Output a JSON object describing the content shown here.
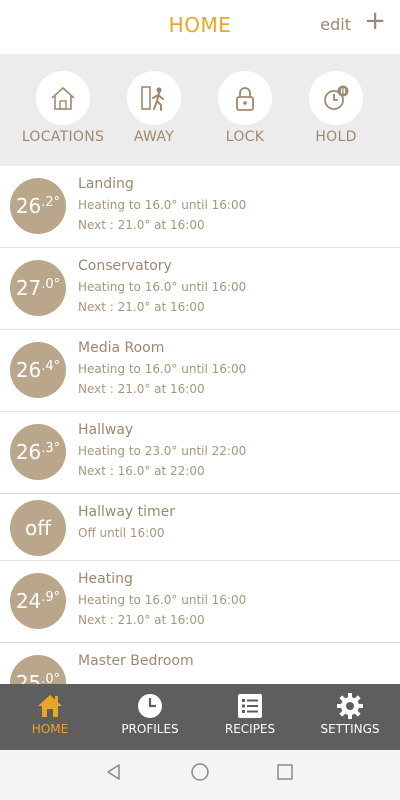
{
  "header": {
    "title": "HOME",
    "edit_label": "edit",
    "add_label": "+"
  },
  "actions": [
    {
      "label": "LOCATIONS",
      "icon": "home-outline-icon"
    },
    {
      "label": "AWAY",
      "icon": "person-exit-icon"
    },
    {
      "label": "LOCK",
      "icon": "padlock-icon"
    },
    {
      "label": "HOLD",
      "icon": "clock-pause-icon"
    }
  ],
  "zones": [
    {
      "name": "Landing",
      "temp_int": "26",
      "temp_dec": ".2°",
      "status": "Heating to 16.0° until 16:00",
      "next": "Next : 21.0° at 16:00"
    },
    {
      "name": "Conservatory",
      "temp_int": "27",
      "temp_dec": ".0°",
      "status": "Heating to 16.0° until 16:00",
      "next": "Next : 21.0° at 16:00"
    },
    {
      "name": "Media Room",
      "temp_int": "26",
      "temp_dec": ".4°",
      "status": "Heating to 16.0° until 16:00",
      "next": "Next : 21.0° at 16:00"
    },
    {
      "name": "Hallway",
      "temp_int": "26",
      "temp_dec": ".3°",
      "status": "Heating to 23.0° until 22:00",
      "next": "Next : 16.0° at 22:00"
    },
    {
      "name": "Hallway timer",
      "temp_text": "off",
      "status": "Off until 16:00"
    },
    {
      "name": "Heating",
      "temp_int": "24",
      "temp_dec": ".9°",
      "status": "Heating to 16.0° until 16:00",
      "next": "Next : 21.0° at 16:00"
    },
    {
      "name": "Master Bedroom",
      "temp_int": "25",
      "temp_dec": ".0°"
    }
  ],
  "bottom_nav": [
    {
      "label": "HOME",
      "icon": "home-icon",
      "active": true
    },
    {
      "label": "PROFILES",
      "icon": "clock-icon"
    },
    {
      "label": "RECIPES",
      "icon": "list-icon"
    },
    {
      "label": "SETTINGS",
      "icon": "gear-icon"
    }
  ],
  "colors": {
    "accent": "#e8a628",
    "tan": "#baa68a",
    "text_brown": "#9c8870",
    "nav_bg": "#5e5e5e"
  }
}
